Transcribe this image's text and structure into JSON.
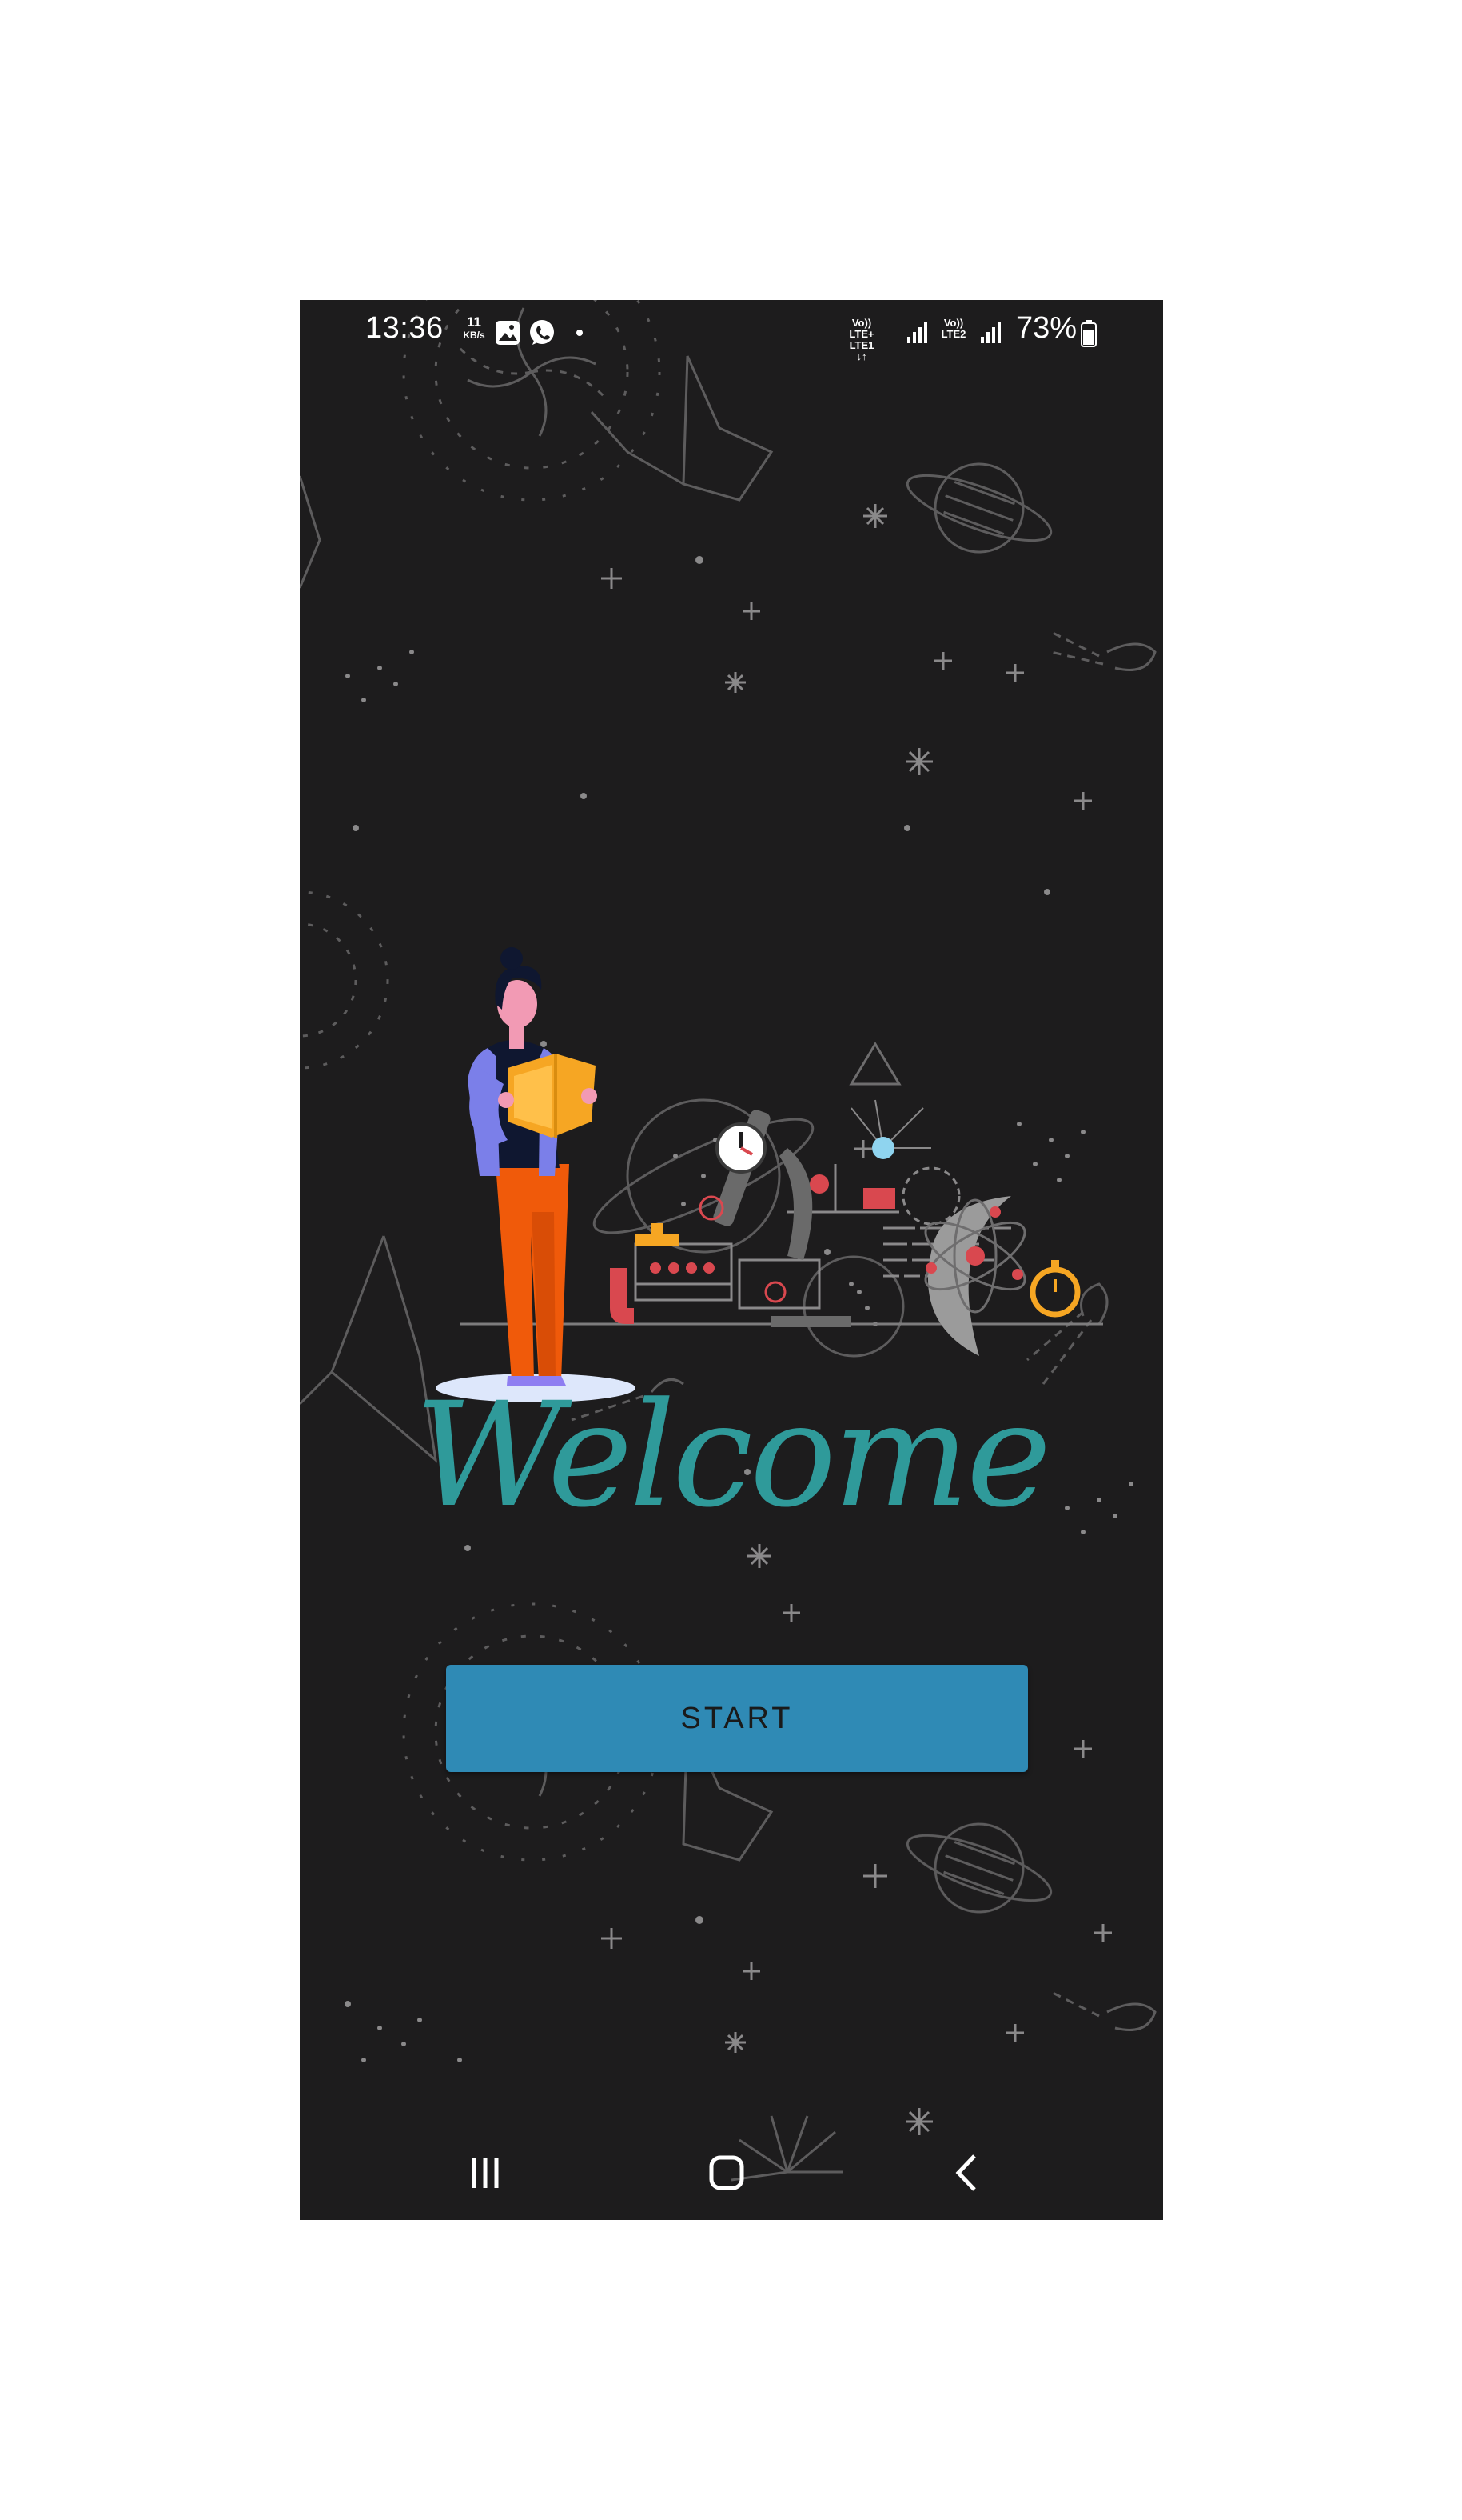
{
  "status_bar": {
    "time": "13:36",
    "net_speed_value": "11",
    "net_speed_unit": "KB/s",
    "sim1_top": "Vo)) LTE+",
    "sim1_bottom": "LTE1 ↓↑",
    "sim2_top": "Vo))",
    "sim2_bottom": "LTE2",
    "battery_percent": "73%"
  },
  "main": {
    "welcome_text": "Welcome",
    "start_label": "START"
  },
  "colors": {
    "background": "#1d1c1d",
    "welcome": "#2f9a9a",
    "button": "#2f8ab5"
  },
  "icons": {
    "gallery": "gallery-icon",
    "whatsapp": "whatsapp-icon",
    "recent_apps": "recent-apps-icon",
    "home": "home-icon",
    "back": "back-icon"
  }
}
